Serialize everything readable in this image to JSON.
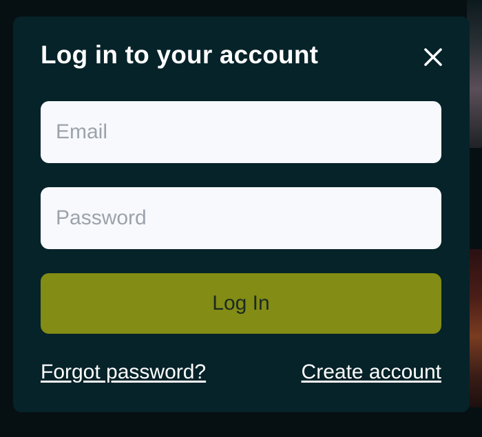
{
  "modal": {
    "title": "Log in to your account",
    "close_icon": "close-icon"
  },
  "form": {
    "email": {
      "placeholder": "Email",
      "value": ""
    },
    "password": {
      "placeholder": "Password",
      "value": ""
    },
    "submit_label": "Log In"
  },
  "links": {
    "forgot_password": "Forgot password?",
    "create_account": "Create account"
  },
  "colors": {
    "backdrop": "#061013",
    "modal_background": "#062329",
    "input_background": "#f8f9fd",
    "button_background": "#838c14",
    "text_primary": "#ffffff"
  }
}
